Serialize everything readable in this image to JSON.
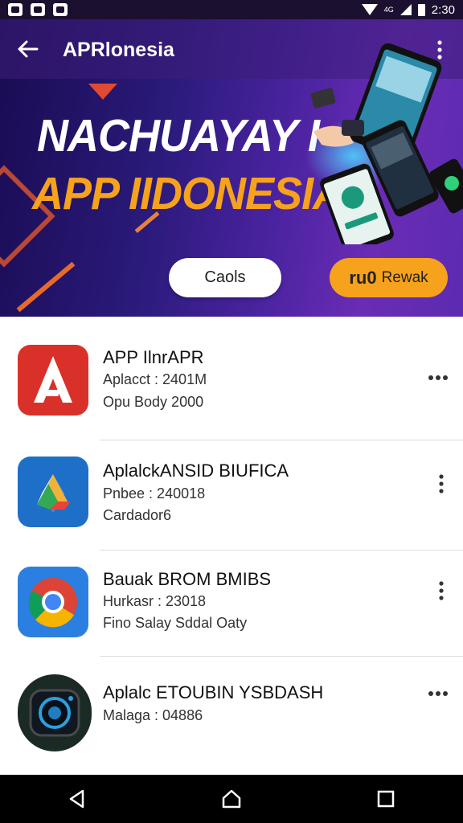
{
  "status_bar": {
    "time": "2:30",
    "net": "4G"
  },
  "appbar": {
    "title": "APRlonesia"
  },
  "banner": {
    "headline_line1": "NACHUAYAY I",
    "headline_line2": "APP IIDONESIA",
    "button_left": "Caols",
    "button_right_glyph": "ru0",
    "button_right": "Rewak"
  },
  "apps": [
    {
      "name": "APP IlnrAPR",
      "line1": "Aplacct : 2401M",
      "line2": "Opu Body 2000",
      "icon": "adobe-a-icon",
      "menu": "horizontal"
    },
    {
      "name": "AplalckANSID BIUFICA",
      "line1": "Pnbee : 240018",
      "line2": "Cardador6",
      "icon": "drive-triangle-icon",
      "menu": "vertical"
    },
    {
      "name": "Bauak BROM BMIBS",
      "line1": "Hurkasr : 23018",
      "line2": "Fino Salay Sddal Oaty",
      "icon": "chrome-icon",
      "menu": "vertical"
    },
    {
      "name": "Aplalc ETOUBIN YSBDASH",
      "line1": "Malaga : 04886",
      "line2": "",
      "icon": "camera-lens-icon",
      "menu": "horizontal"
    }
  ],
  "colors": {
    "accent_orange": "#f7a21c",
    "banner_dark": "#1a0b52",
    "banner_purple": "#6a2cb5"
  }
}
